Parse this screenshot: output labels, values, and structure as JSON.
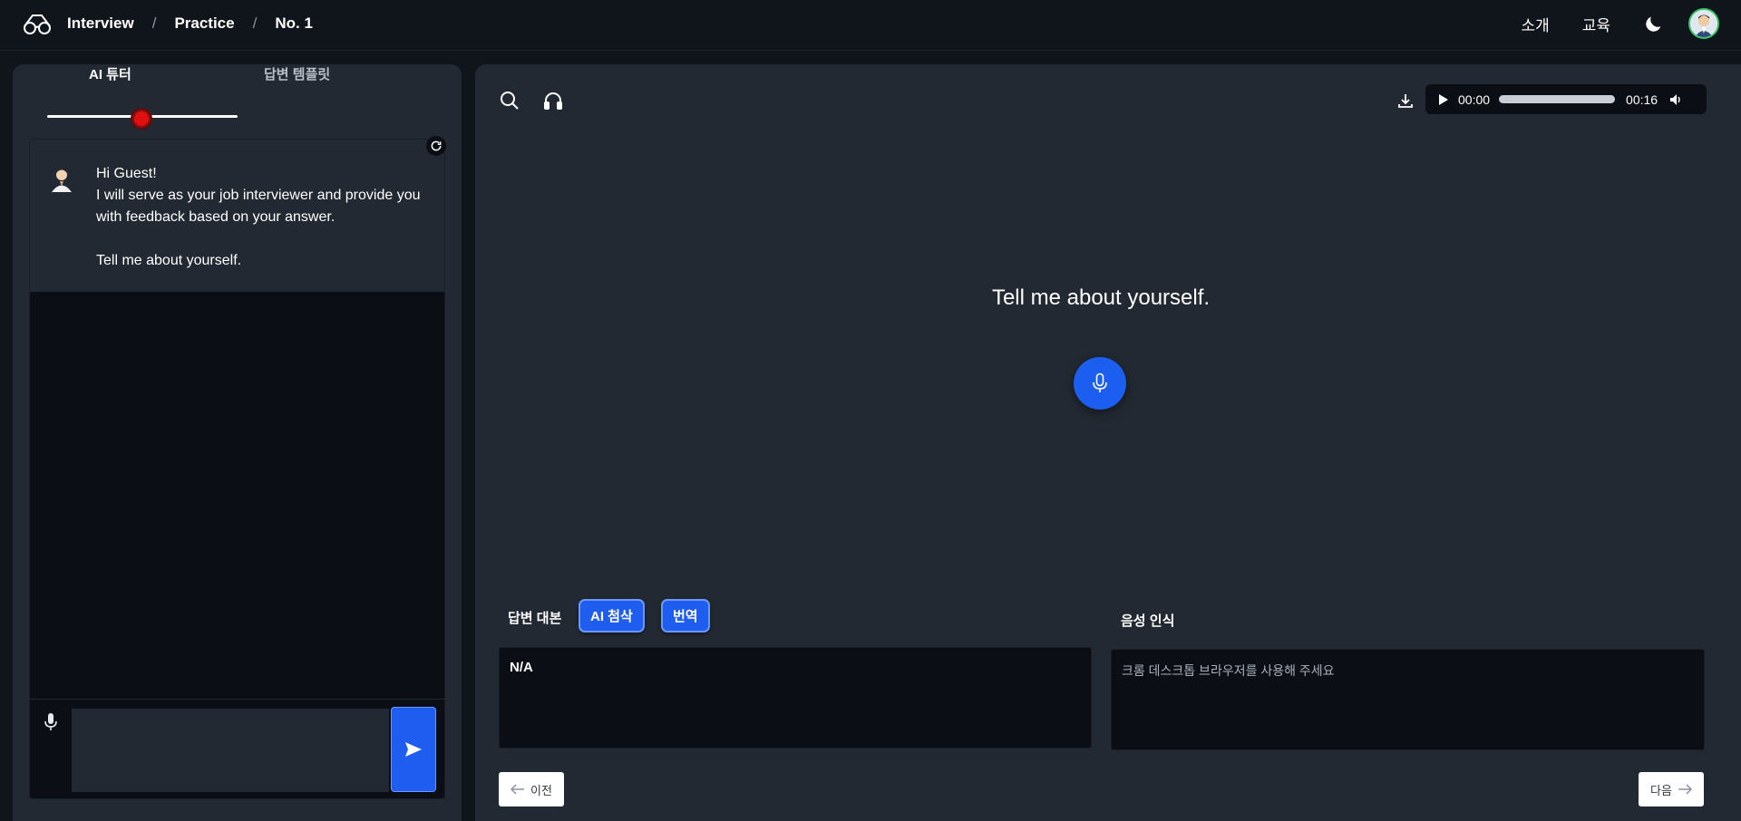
{
  "header": {
    "breadcrumbs": [
      "Interview",
      "Practice",
      "No. 1"
    ],
    "links": [
      "소개",
      "교육"
    ]
  },
  "left": {
    "tabs": [
      {
        "label": "AI 튜터",
        "active": true
      },
      {
        "label": "답변 템플릿",
        "active": false
      }
    ],
    "message_lines": [
      "Hi Guest!",
      "I will serve as your job interviewer and provide you with feedback based on your answer.",
      "",
      "Tell me about yourself."
    ],
    "input_value": ""
  },
  "main": {
    "audio": {
      "current": "00:00",
      "duration": "00:16"
    },
    "question": "Tell me about yourself.",
    "script_title": "답변 대본",
    "ai_button": "AI 첨삭",
    "translate_button": "번역",
    "script_value": "N/A",
    "speech_title": "음성 인식",
    "speech_placeholder": "크롬 데스크톱 브라우저를 사용해 주세요",
    "prev_label": "이전",
    "next_label": "다음"
  },
  "colors": {
    "accent": "#1f5cf0",
    "record_dot": "#e10f0f",
    "avatar_ring": "#35c46a"
  }
}
